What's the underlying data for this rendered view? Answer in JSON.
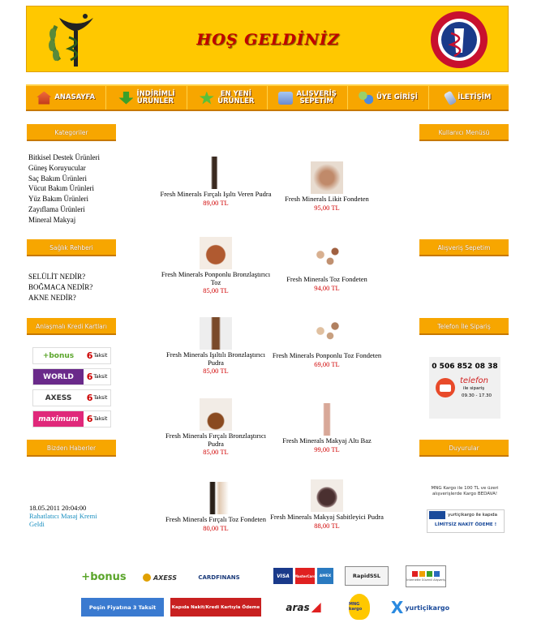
{
  "header": {
    "title": "HOŞ GELDİNİZ",
    "seal_text": "T.C. SAĞLIK BAKANLIĞI · REPUBLIC OF TURKEY MINISTRY OF HEALTH"
  },
  "nav": [
    {
      "label": "ANASAYFA",
      "icon": "home-icon",
      "color": "#e84a2a"
    },
    {
      "label": "İNDİRİMLİ ÜRÜNLER",
      "icon": "down-arrow-icon",
      "color": "#3aa02a"
    },
    {
      "label": "EN YENİ ÜRÜNLER",
      "icon": "star-icon",
      "color": "#4ab03a"
    },
    {
      "label": "ALIŞVERİŞ SEPETİM",
      "icon": "basket-icon",
      "color": "#7aa0e0"
    },
    {
      "label": "ÜYE GİRİŞİ",
      "icon": "members-icon",
      "color": "#3a7ae0"
    },
    {
      "label": "İLETİŞİM",
      "icon": "phone-icon",
      "color": "#9ab0d0"
    }
  ],
  "left": {
    "categories_title": "Kategoriler",
    "categories": [
      "Bitkisel Destek Ürünleri",
      "Güneş Koruyucular",
      "Saç Bakım Ürünleri",
      "Vücut Bakım Ürünleri",
      "Yüz Bakım Ürünleri",
      "Zayıflama Ürünleri",
      "Mineral Makyaj"
    ],
    "health_title": "Sağlık Rehberi",
    "health": [
      "SELÜLİT NEDİR?",
      "BOĞMACA NEDİR?",
      "AKNE NEDİR?"
    ],
    "cards_title": "Anlaşmalı Kredi Kartları",
    "cards": [
      {
        "brand": "+bonus",
        "color": "#ffffff",
        "text_color": "#5aa52a",
        "taksit": "Taksit",
        "count": "6"
      },
      {
        "brand": "WORLD",
        "color": "#6a2a8a",
        "text_color": "#ffffff",
        "taksit": "Taksit",
        "count": "6"
      },
      {
        "brand": "AXESS",
        "color": "#ffffff",
        "text_color": "#333333",
        "taksit": "Taksit",
        "count": "6"
      },
      {
        "brand": "maximum",
        "color": "#e0287a",
        "text_color": "#ffffff",
        "taksit": "Taksit",
        "count": "6"
      }
    ],
    "news_title": "Bizden Haberler",
    "news_date": "18.05.2011 20:04:00",
    "news_link": "Rahatlatıcı Masaj Kremi Geldi"
  },
  "right": {
    "user_menu_title": "Kullanıcı Menüsü",
    "cart_title": "Alışveriş Sepetim",
    "phone_title": "Telefon İle Sipariş",
    "phone_number": "0 506 852 08 38",
    "phone_label": "telefon",
    "phone_sub": "ile sipariş",
    "phone_hours": "09.30 - 17.30",
    "announce_title": "Duyurular",
    "announce_text1": "MNG Kargo ile 100 TL ve üzeri alışverişlerde Kargo BEDAVA!",
    "announce_text2": "yurtiçikargo ile kapıda",
    "announce_text3": "LİMİTSİZ NAKİT ÖDEME !"
  },
  "products": [
    {
      "name": "Fresh Minerals Fırçalı Işıltı Veren Pudra",
      "price": "89,00 TL"
    },
    {
      "name": "Fresh Minerals Likit Fondeten",
      "price": "95,00 TL"
    },
    {
      "name": "Fresh Minerals Ponponlu Bronzlaştırıcı Toz",
      "price": "85,00 TL"
    },
    {
      "name": "Fresh Minerals Toz Fondeten",
      "price": "94,00 TL"
    },
    {
      "name": "Fresh Minerals Işıltılı Bronzlaştırıcı Pudra",
      "price": "85,00 TL"
    },
    {
      "name": "Fresh Minerals Ponponlu Toz Fondeten",
      "price": "69,00 TL"
    },
    {
      "name": "Fresh Minerals Fırçalı Bronzlaştırıcı Pudra",
      "price": "85,00 TL"
    },
    {
      "name": "Fresh Minerals Makyaj Altı Baz",
      "price": "99,00 TL"
    },
    {
      "name": "Fresh Minerals Fırçalı Toz Fondeten",
      "price": "80,00 TL"
    },
    {
      "name": "Fresh Minerals Makyaj Sabitleyici Pudra",
      "price": "88,00 TL"
    }
  ],
  "footer": {
    "bonus": "+bonus",
    "axess": "AXESS",
    "cardfinans": "CARDFINANS",
    "visa": "VISA",
    "mastercard": "MasterCard",
    "amex": "AMEX",
    "rapidssl": "RapidSSL",
    "trust": "İnternette Güvenli Alışveriş",
    "pesin": "Peşin Fiyatına 3 Taksit",
    "kapida": "Kapıda Nakit/Kredi Kartıyla Ödeme",
    "aras": "aras",
    "mng": "MNG kargo",
    "yurtici": "yurtiçikargo"
  }
}
